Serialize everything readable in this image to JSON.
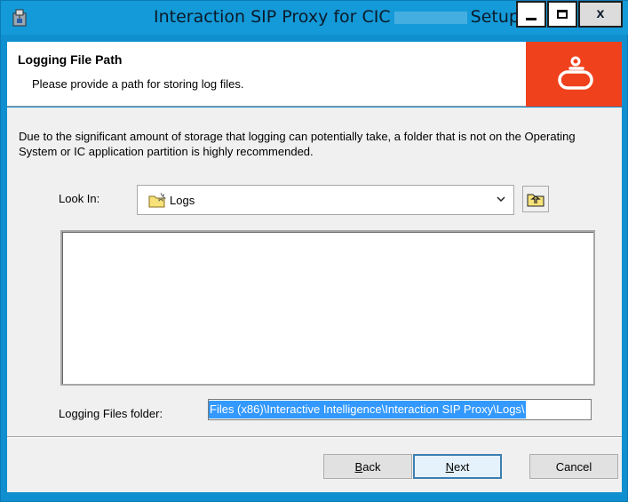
{
  "window": {
    "title_prefix": "Interaction SIP Proxy for CIC",
    "title_suffix": "Setup",
    "close_label": "x"
  },
  "header": {
    "title": "Logging File Path",
    "subtitle": "Please provide a path for storing log files."
  },
  "content": {
    "description": "Due to the significant amount of storage that logging can potentially take, a folder that is not on the Operating System or IC application partition is highly recommended.",
    "look_in_label": "Look In:",
    "look_in_value": "Logs",
    "logging_folder_label": "Logging Files folder:",
    "logging_folder_value": "Files (x86)\\Interactive Intelligence\\Interaction SIP Proxy\\Logs\\"
  },
  "footer": {
    "back_prefix": "",
    "back_mnemonic": "B",
    "back_rest": "ack",
    "next_mnemonic": "N",
    "next_rest": "ext",
    "cancel_label": "Cancel"
  },
  "colors": {
    "titlebar": "#149ad8",
    "logo_bg": "#f0411d",
    "selection": "#3399ff"
  }
}
